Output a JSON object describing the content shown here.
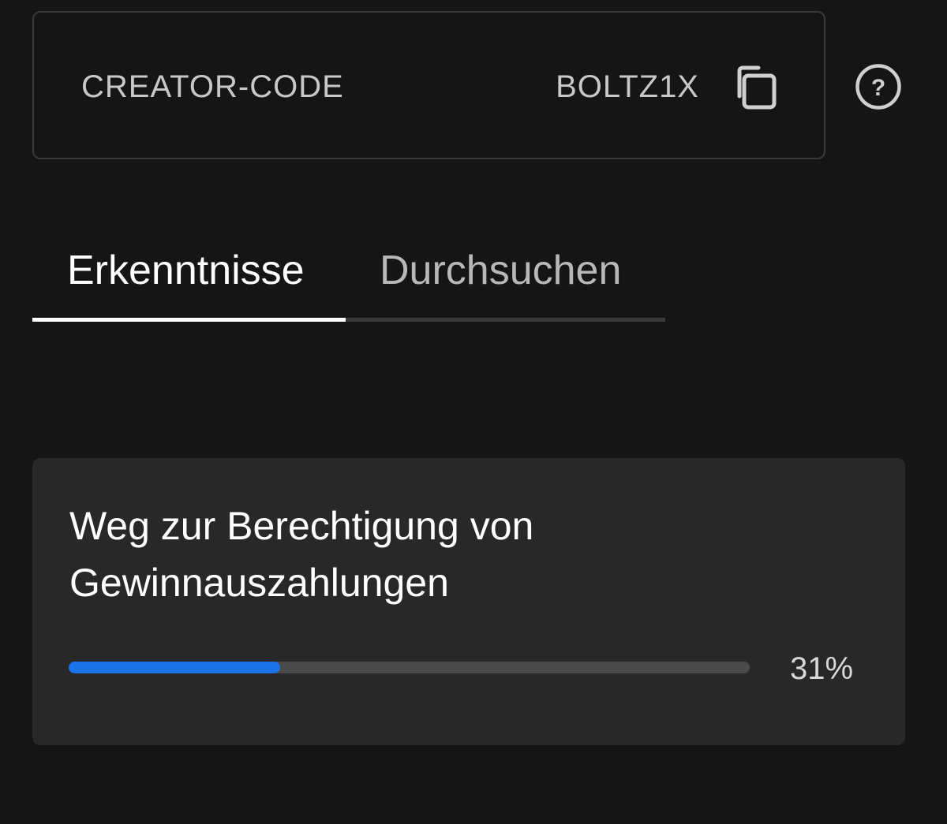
{
  "creator_code": {
    "label": "CREATOR-CODE",
    "value": "BOLTZ1X",
    "copy_icon": "copy-icon",
    "help_icon": "help-icon",
    "help_symbol": "?"
  },
  "tabs": [
    {
      "label": "Erkenntnisse",
      "active": true
    },
    {
      "label": "Durchsuchen",
      "active": false
    }
  ],
  "eligibility": {
    "title": "Weg zur Berechtigung von Gewinnauszahlungen",
    "progress_percent": 31,
    "progress_text": "31%",
    "progress_color": "#1a73e8"
  }
}
